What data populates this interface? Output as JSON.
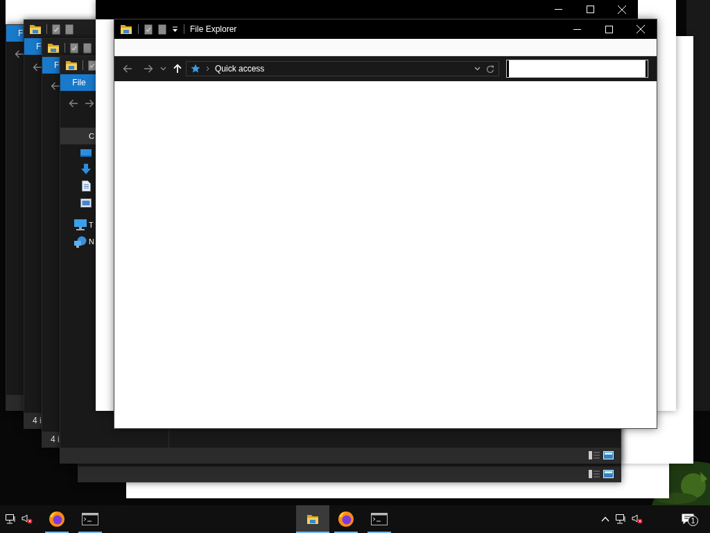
{
  "background_windows": [
    {
      "title_bar": false,
      "file_tab": "F"
    },
    {
      "title_bar": true,
      "file_tab": "F",
      "status": "4 i"
    },
    {
      "title_bar": true,
      "file_tab": "F",
      "status": "4 i"
    },
    {
      "title_bar": true,
      "file_tab": "File",
      "nav_items": [
        {
          "kind": "quick-access",
          "label": "C",
          "selected": true,
          "children": [
            {
              "kind": "desktop",
              "selected": false
            },
            {
              "kind": "downloads",
              "selected": false
            },
            {
              "kind": "documents",
              "selected": false
            },
            {
              "kind": "pictures",
              "selected": false
            }
          ]
        },
        {
          "kind": "this-pc",
          "label": "T",
          "selected": false
        },
        {
          "kind": "network",
          "label": "N",
          "selected": false
        }
      ]
    },
    {
      "title_bar": false
    }
  ],
  "front_window": {
    "title": "File Explorer",
    "location": "Quick access"
  },
  "taskbar": {
    "left_tray": {
      "volume_muted": true
    },
    "pinned_left": [
      {
        "kind": "browser",
        "running": true
      },
      {
        "kind": "terminal",
        "running": true
      }
    ],
    "apps": [
      {
        "kind": "folder",
        "selected": true,
        "running": true
      },
      {
        "kind": "browser",
        "selected": false,
        "running": true
      },
      {
        "kind": "terminal",
        "selected": false,
        "running": true
      }
    ],
    "right_tray": {
      "volume_muted": true
    },
    "notifications": {
      "count": "1"
    }
  }
}
